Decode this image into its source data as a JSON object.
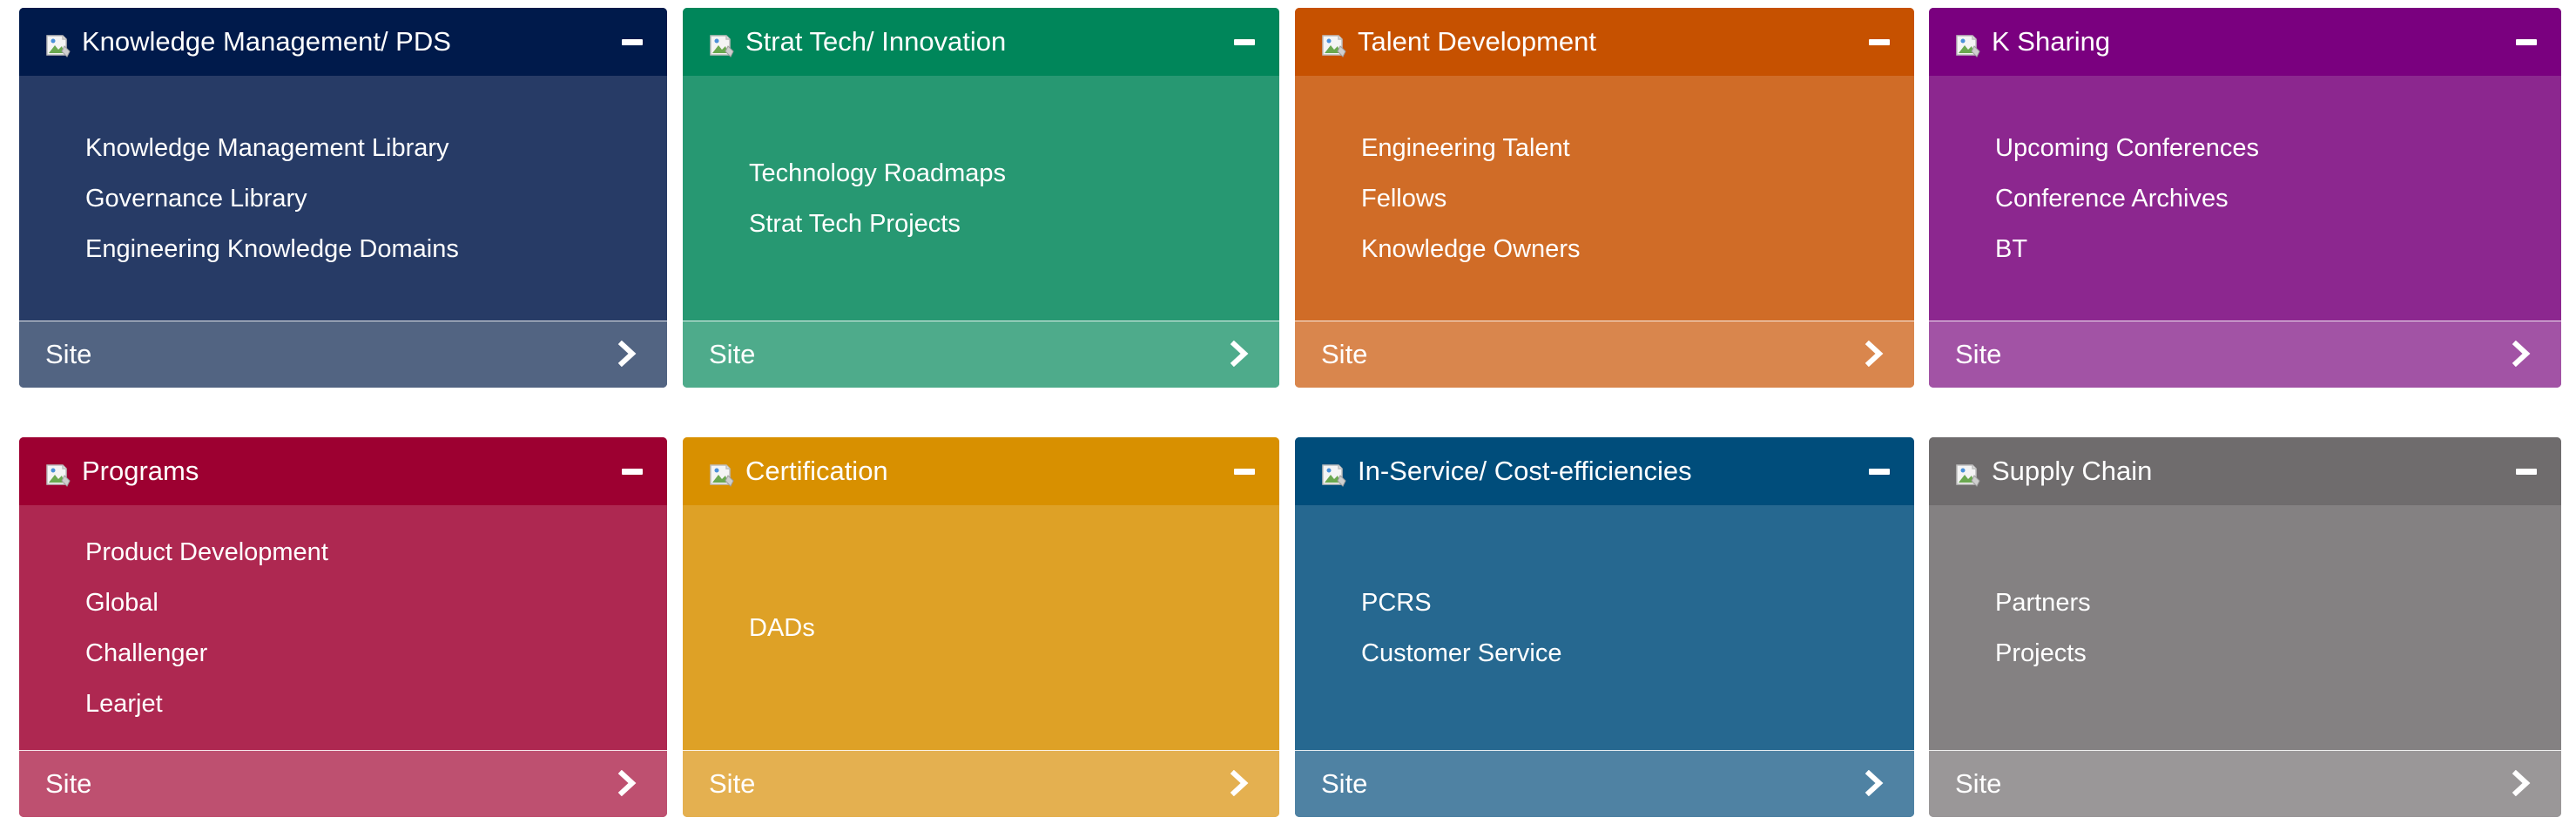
{
  "tiles": [
    {
      "key": "km",
      "title": "Knowledge Management/ PDS",
      "links": [
        "Knowledge Management Library",
        "Governance Library",
        "Engineering Knowledge Domains"
      ],
      "footer_label": "Site",
      "colors": {
        "header": "#001A4B",
        "body": "#273B66",
        "footer": "#526482"
      }
    },
    {
      "key": "strat",
      "title": "Strat Tech/ Innovation",
      "links": [
        "Technology Roadmaps",
        "Strat Tech Projects"
      ],
      "footer_label": "Site",
      "colors": {
        "header": "#00865A",
        "body": "#279872",
        "footer": "#4EAB8B"
      }
    },
    {
      "key": "talent",
      "title": "Talent Development",
      "links": [
        "Engineering Talent",
        "Fellows",
        "Knowledge Owners"
      ],
      "footer_label": "Site",
      "colors": {
        "header": "#C65100",
        "body": "#D06C27",
        "footer": "#D9864D"
      }
    },
    {
      "key": "ksharing",
      "title": "K Sharing",
      "links": [
        "Upcoming Conferences",
        "Conference Archives",
        "BT"
      ],
      "footer_label": "Site",
      "colors": {
        "header": "#7A007F",
        "body": "#8C278F",
        "footer": "#A253A5"
      }
    },
    {
      "key": "programs",
      "title": "Programs",
      "links": [
        "Product Development",
        "Global",
        "Challenger",
        "Learjet"
      ],
      "footer_label": "Site",
      "colors": {
        "header": "#9D0031",
        "body": "#AE2851",
        "footer": "#BE5070"
      }
    },
    {
      "key": "cert",
      "title": "Certification",
      "links": [
        "DADs"
      ],
      "footer_label": "Site",
      "colors": {
        "header": "#D89000",
        "body": "#DEA126",
        "footer": "#E4B050"
      }
    },
    {
      "key": "inservice",
      "title": "In-Service/ Cost-efficiencies",
      "links": [
        "PCRS",
        "Customer Service"
      ],
      "footer_label": "Site",
      "colors": {
        "header": "#004D7B",
        "body": "#266890",
        "footer": "#4F82A3"
      }
    },
    {
      "key": "supply",
      "title": "Supply Chain",
      "links": [
        "Partners",
        "Projects"
      ],
      "footer_label": "Site",
      "colors": {
        "header": "#6F6C6D",
        "body": "#848182",
        "footer": "#9A9798"
      }
    }
  ],
  "icons": {
    "tile": "broken-image-icon",
    "collapse": "minus-icon",
    "footer": "chevron-right-icon"
  }
}
